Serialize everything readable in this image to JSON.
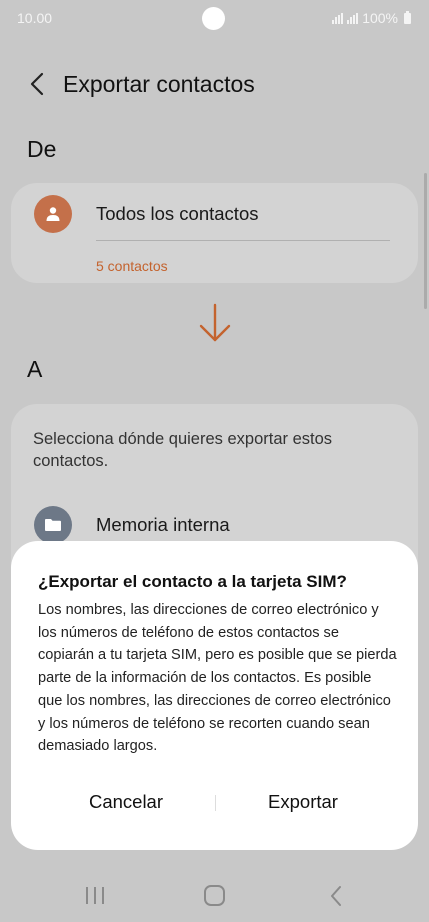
{
  "status_bar": {
    "time": "10.00",
    "battery_text": "100%",
    "icons": [
      "signal-icon",
      "signal-icon",
      "battery-icon"
    ]
  },
  "header": {
    "title": "Exportar contactos",
    "back_icon": "back-arrow-icon"
  },
  "from_section": {
    "label": "De",
    "option": {
      "icon": "person-icon",
      "label": "Todos los contactos",
      "count": "5 contactos"
    },
    "accent_color": "#c4632e"
  },
  "to_section": {
    "label": "A",
    "prompt": "Selecciona dónde quieres exportar estos contactos.",
    "option": {
      "icon": "folder-icon",
      "label": "Memoria interna"
    }
  },
  "dialog": {
    "title": "¿Exportar el contacto a la tarjeta SIM?",
    "body": "Los nombres, las direcciones de correo electrónico y los números de teléfono de estos contactos se copiarán a tu tarjeta SIM, pero es posible que se pierda parte de la información de los contactos. Es posible que los nombres, las direcciones de correo electrónico y los números de teléfono se recorten cuando sean demasiado largos.",
    "cancel_label": "Cancelar",
    "confirm_label": "Exportar"
  },
  "nav_bar": {
    "icons": [
      "recent-apps-icon",
      "home-icon",
      "back-icon"
    ]
  }
}
